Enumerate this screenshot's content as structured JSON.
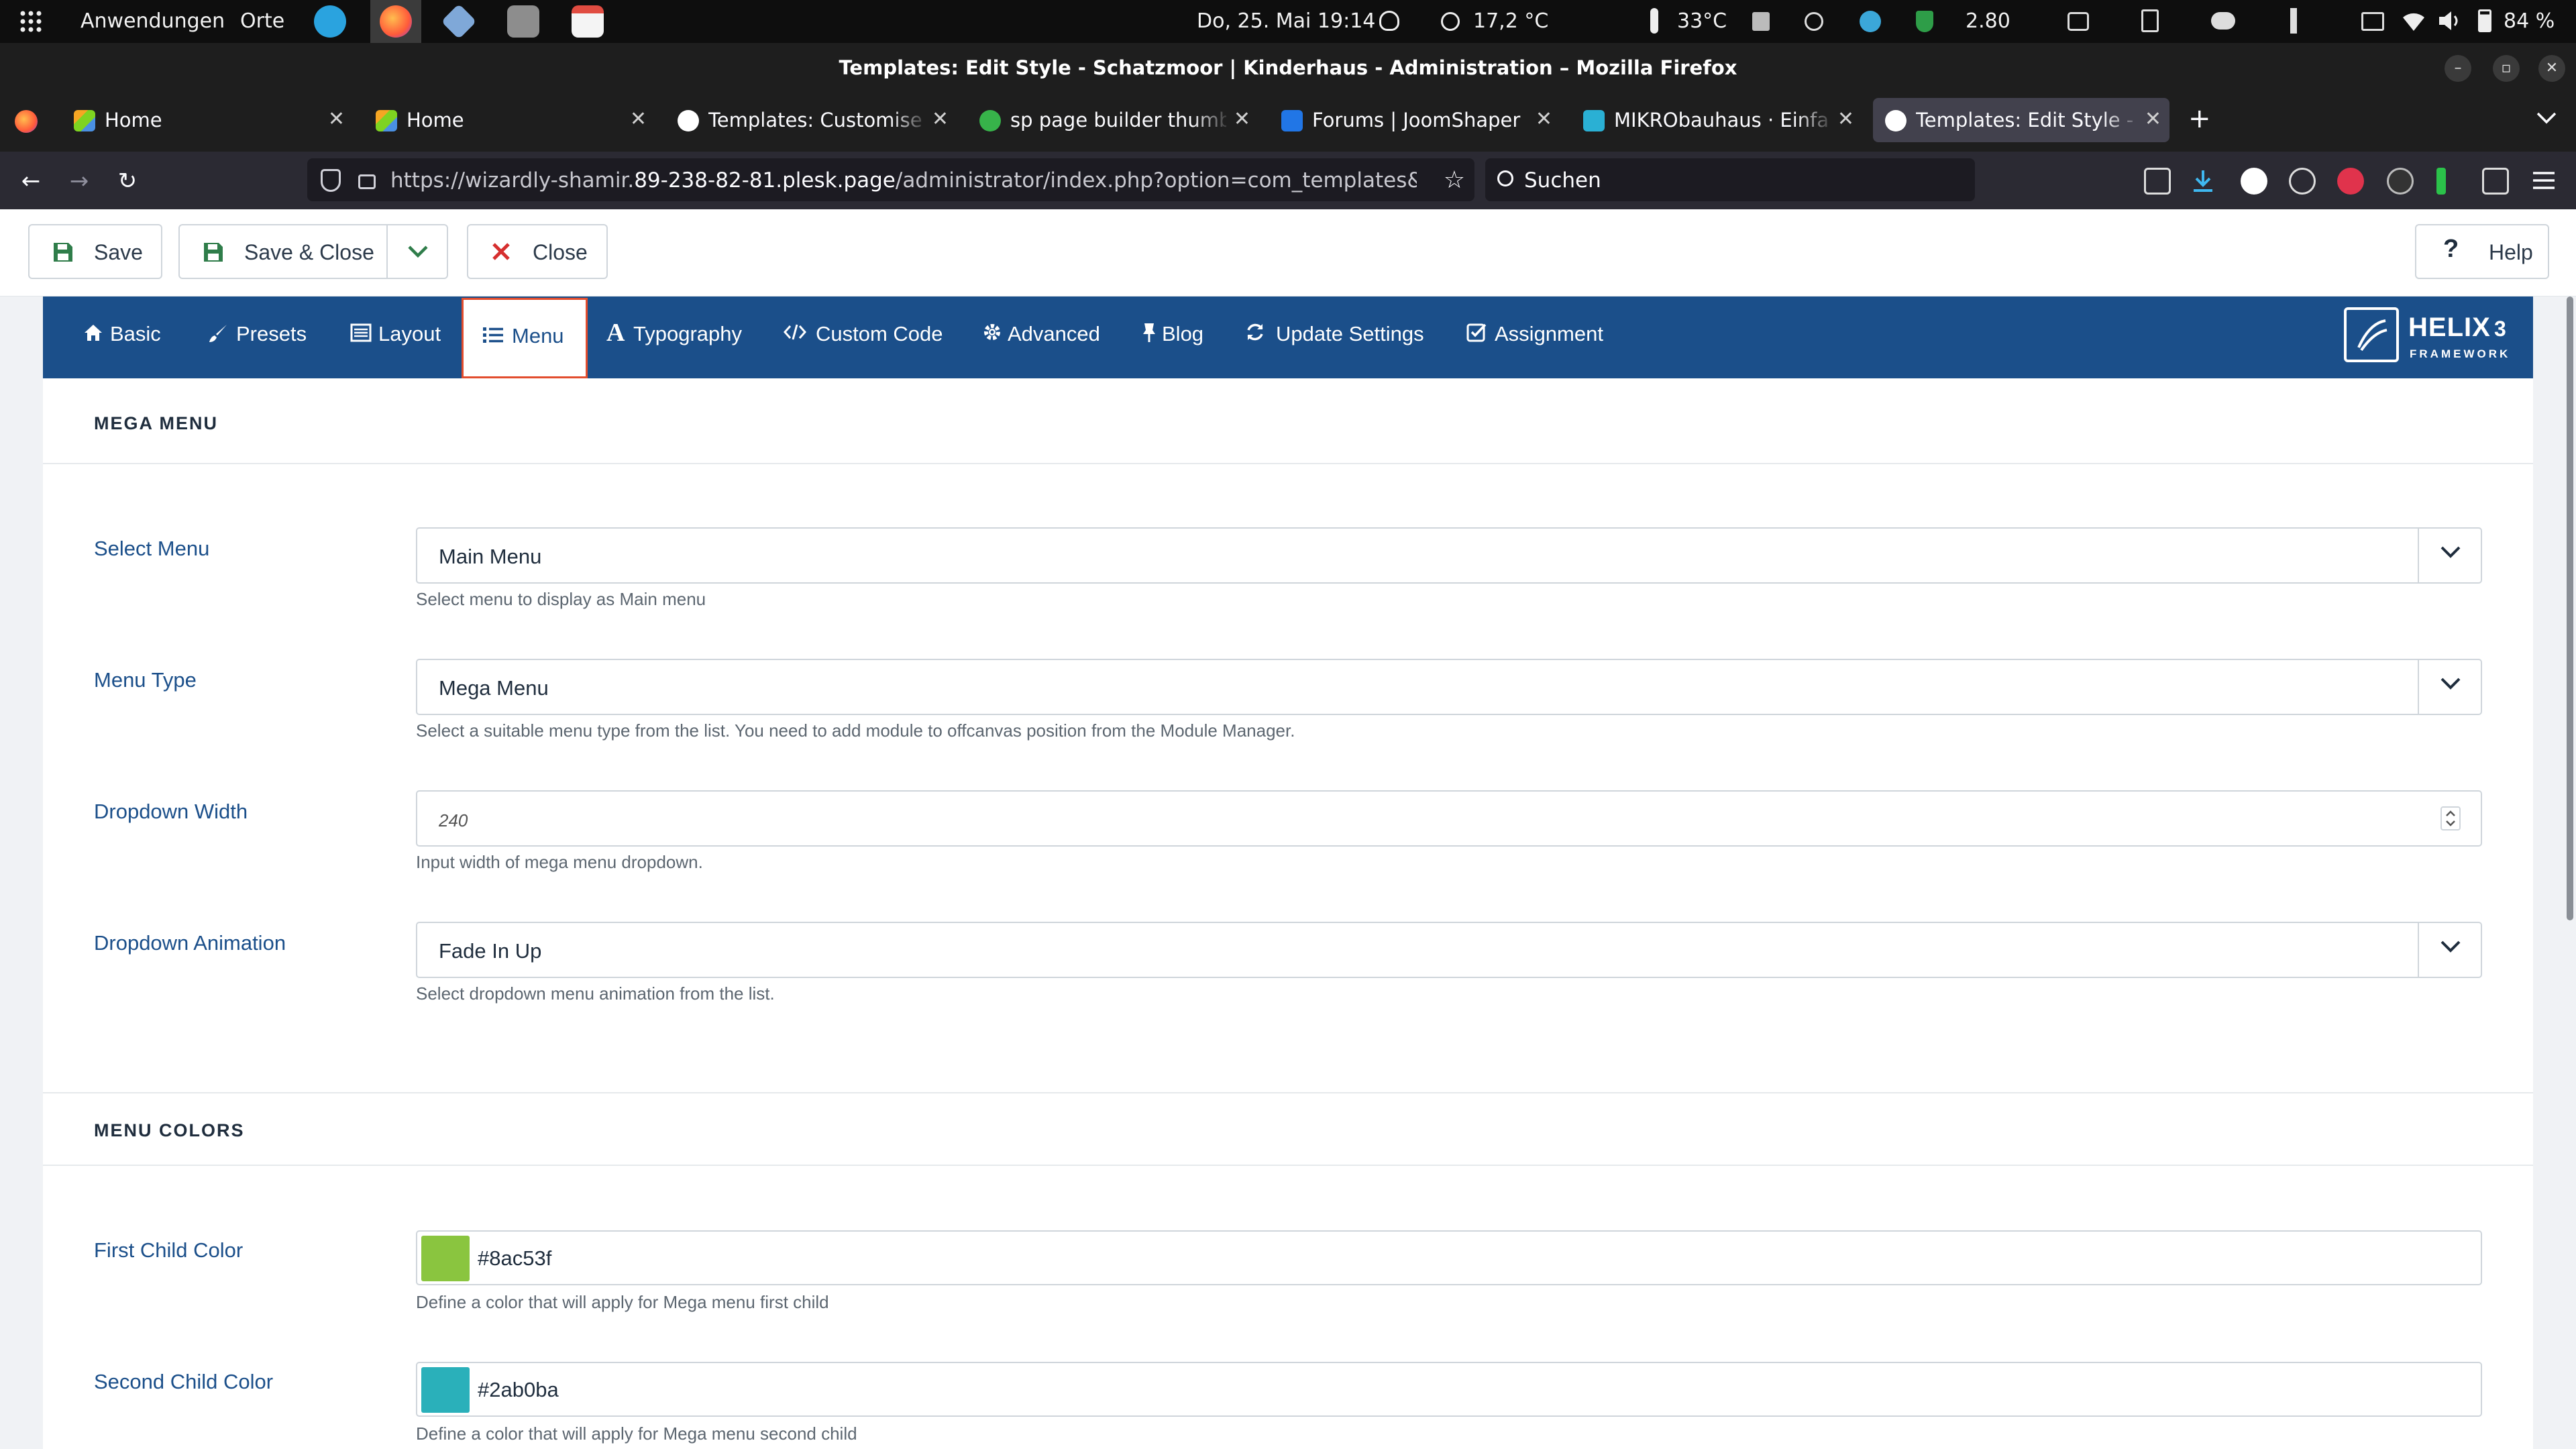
{
  "gnome": {
    "apps_label": "Anwendungen",
    "places_label": "Orte",
    "datetime": "Do, 25. Mai  19:14",
    "weather": "17,2 °C",
    "temperature": "33°C",
    "net_speed": "2.80",
    "battery": "84 %"
  },
  "window": {
    "title": "Templates: Edit Style - Schatzmoor | Kinderhaus - Administration – Mozilla Firefox"
  },
  "tabs": [
    {
      "label": "Home"
    },
    {
      "label": "Home"
    },
    {
      "label": "Templates: Customise (Sl"
    },
    {
      "label": "sp page builder thumbsli"
    },
    {
      "label": "Forums | JoomShaper"
    },
    {
      "label": "MIKRObauhaus · Einfamil"
    },
    {
      "label": "Templates: Edit Style - Sc"
    }
  ],
  "nav": {
    "url_prefix": "https://wizardly-shamir.",
    "url_host": "89-238-82-81.plesk.page",
    "url_path": "/administrator/index.php?option=com_templates&view=style&",
    "search_placeholder": "Suchen"
  },
  "toolbar": {
    "save_label": "Save",
    "save_close_label": "Save & Close",
    "close_label": "Close",
    "help_label": "Help"
  },
  "helix_tabs": [
    {
      "label": "Basic"
    },
    {
      "label": "Presets"
    },
    {
      "label": "Layout"
    },
    {
      "label": "Menu"
    },
    {
      "label": "Typography"
    },
    {
      "label": "Custom Code"
    },
    {
      "label": "Advanced"
    },
    {
      "label": "Blog"
    },
    {
      "label": "Update Settings"
    },
    {
      "label": "Assignment"
    }
  ],
  "helix_logo": {
    "name": "HELIX",
    "version": "3",
    "sub": "FRAMEWORK"
  },
  "sections": {
    "mega_menu": "MEGA MENU",
    "menu_colors": "MENU COLORS"
  },
  "fields": {
    "select_menu": {
      "label": "Select Menu",
      "value": "Main Menu",
      "help": "Select menu to display as Main menu"
    },
    "menu_type": {
      "label": "Menu Type",
      "value": "Mega Menu",
      "help": "Select a suitable menu type from the list. You need to add module to offcanvas position from the Module Manager."
    },
    "dropdown_width": {
      "label": "Dropdown Width",
      "value": "240",
      "help": "Input width of mega menu dropdown."
    },
    "dropdown_animation": {
      "label": "Dropdown Animation",
      "value": "Fade In Up",
      "help": "Select dropdown menu animation from the list."
    },
    "first_child_color": {
      "label": "First Child Color",
      "value": "#8ac53f",
      "help": "Define a color that will apply for Mega menu first child"
    },
    "second_child_color": {
      "label": "Second Child Color",
      "value": "#2ab0ba",
      "help": "Define a color that will apply for Mega menu second child"
    }
  },
  "colors": {
    "brand_blue": "#1b4f8a",
    "active_tab_border": "#e24d2e",
    "first_child": "#8ac53f",
    "second_child": "#2ab0ba"
  }
}
